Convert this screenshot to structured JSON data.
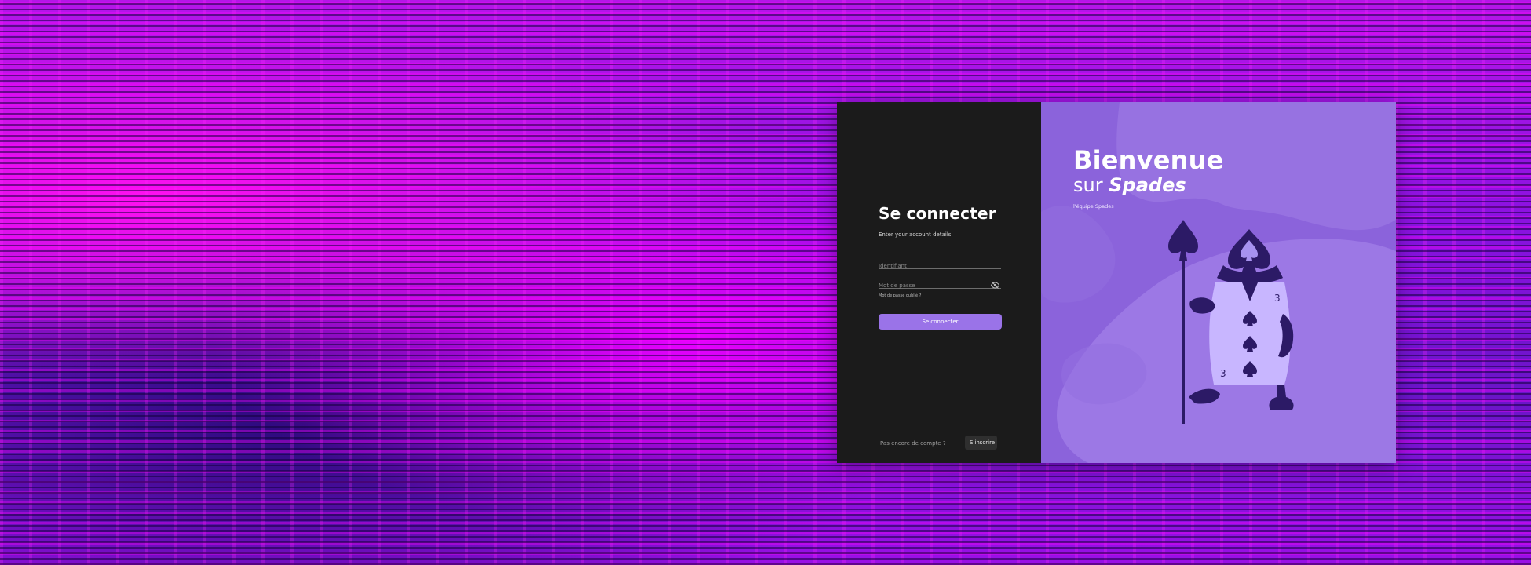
{
  "login": {
    "title": "Se connecter",
    "subtitle": "Enter your account details",
    "username_placeholder": "Identifiant",
    "password_placeholder": "Mot de passe",
    "forgot_link": "Mot de passe oublié ?",
    "submit_label": "Se connecter",
    "no_account_text": "Pas encore de compte ?",
    "signup_label": "S'inscrire"
  },
  "welcome": {
    "line1": "Bienvenue",
    "line2_prefix": "sur",
    "brand": "Spades",
    "team": "l'équipe Spades"
  },
  "icons": {
    "password_toggle": "eye-off-icon",
    "illustration": "spade-card-soldier-illustration"
  },
  "colors": {
    "accent": "#9a73e8",
    "panel_dark": "#1b1b1b",
    "panel_purple": "#8b63db",
    "figure_dark": "#2c1a66",
    "figure_light": "#c8b6ff"
  }
}
